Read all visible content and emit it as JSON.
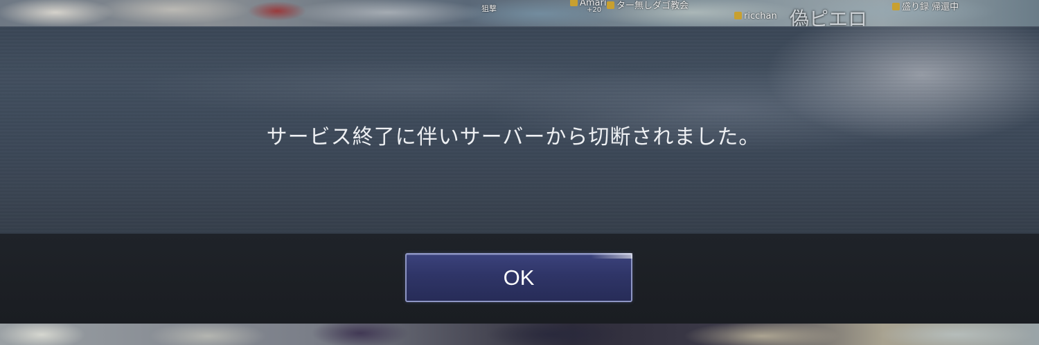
{
  "background": {
    "top_name_tags": [
      {
        "badge": true,
        "text": "Amari"
      },
      {
        "badge": true,
        "text": "ター無しダゴ教会"
      },
      {
        "badge": true,
        "text": "ricchan"
      },
      {
        "badge": true,
        "text": "盛り録 帰還中"
      }
    ],
    "big_name": "偽ピエロ",
    "small_labels": [
      "+20",
      "狙撃"
    ]
  },
  "dialog": {
    "message": "サービス終了に伴いサーバーから切断されました。",
    "ok_label": "OK"
  },
  "colors": {
    "button_fill": "#2f3567",
    "button_border": "#8e96c4",
    "dialog_body": "#3c4858",
    "dialog_footer": "#1c1f24",
    "text": "#eef0f3"
  }
}
